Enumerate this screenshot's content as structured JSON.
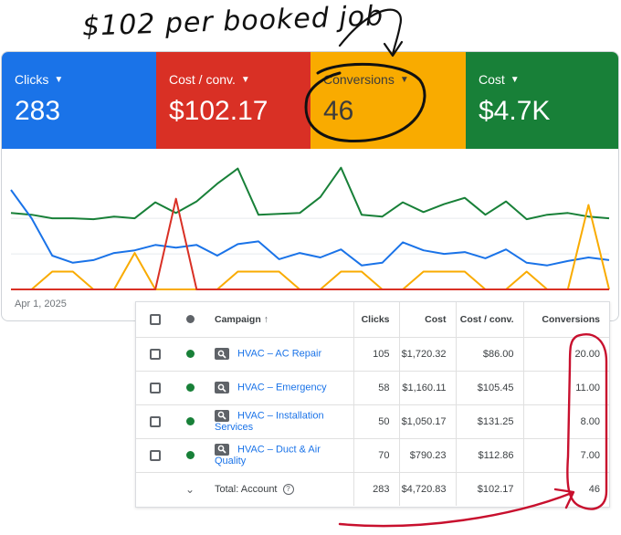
{
  "annotation": {
    "text": "$102 per booked job"
  },
  "metrics": [
    {
      "label": "Clicks",
      "value": "283",
      "color": "#1a73e8"
    },
    {
      "label": "Cost / conv.",
      "value": "$102.17",
      "color": "#d93025"
    },
    {
      "label": "Conversions",
      "value": "46",
      "color": "#f9ab00"
    },
    {
      "label": "Cost",
      "value": "$4.7K",
      "color": "#188038"
    }
  ],
  "chart": {
    "x_start_label": "Apr 1, 2025",
    "colors": {
      "blue": "#1a73e8",
      "red": "#d93025",
      "yellow": "#f9ab00",
      "green": "#188038"
    }
  },
  "chart_data": {
    "type": "line",
    "x_start": "Apr 1, 2025",
    "series": [
      {
        "color": "green",
        "values": [
          86,
          84,
          80,
          80,
          79,
          82,
          80,
          98,
          86,
          99,
          119,
          136,
          84,
          85,
          86,
          104,
          137,
          84,
          82,
          98,
          87,
          96,
          103,
          84,
          99,
          79,
          84,
          86,
          82,
          80
        ]
      },
      {
        "color": "blue",
        "values": [
          112,
          80,
          38,
          30,
          33,
          41,
          44,
          50,
          47,
          50,
          38,
          51,
          54,
          34,
          41,
          36,
          45,
          27,
          30,
          53,
          44,
          40,
          42,
          35,
          45,
          30,
          27,
          32,
          36,
          33
        ]
      },
      {
        "color": "yellow",
        "values": [
          0,
          0,
          20,
          20,
          0,
          0,
          41,
          0,
          0,
          0,
          0,
          20,
          20,
          20,
          0,
          0,
          20,
          20,
          0,
          0,
          20,
          20,
          20,
          0,
          0,
          20,
          0,
          0,
          95,
          0
        ]
      },
      {
        "color": "red",
        "values": [
          0,
          0,
          0,
          0,
          0,
          0,
          0,
          0,
          102,
          0,
          0,
          0,
          0,
          0,
          0,
          0,
          0,
          0,
          0,
          0,
          0,
          0,
          0,
          0,
          0,
          0,
          0,
          0,
          0,
          0
        ]
      }
    ]
  },
  "table": {
    "headers": {
      "campaign": "Campaign",
      "clicks": "Clicks",
      "cost": "Cost",
      "cpc": "Cost / conv.",
      "conversions": "Conversions"
    },
    "rows": [
      {
        "campaign": "HVAC – AC Repair",
        "clicks": "105",
        "cost": "$1,720.32",
        "cpc": "$86.00",
        "conversions": "20.00"
      },
      {
        "campaign": "HVAC – Emergency",
        "clicks": "58",
        "cost": "$1,160.11",
        "cpc": "$105.45",
        "conversions": "11.00"
      },
      {
        "campaign": "HVAC – Installation Services",
        "clicks": "50",
        "cost": "$1,050.17",
        "cpc": "$131.25",
        "conversions": "8.00"
      },
      {
        "campaign": "HVAC – Duct & Air Quality",
        "clicks": "70",
        "cost": "$790.23",
        "cpc": "$112.86",
        "conversions": "7.00"
      }
    ],
    "total": {
      "label": "Total: Account",
      "clicks": "283",
      "cost": "$4,720.83",
      "cpc": "$102.17",
      "conversions": "46"
    }
  }
}
